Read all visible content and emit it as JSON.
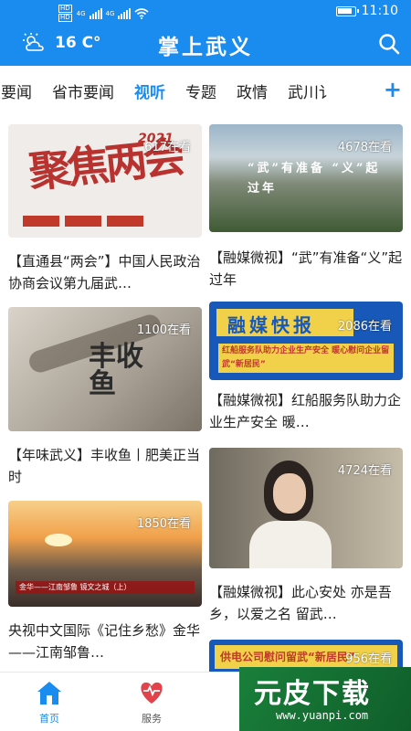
{
  "colors": {
    "accent": "#1a8cf0",
    "header_bg": "#1a8cf0"
  },
  "status": {
    "signal_badge_top": "HD",
    "signal_badge_bottom": "HD",
    "net1": "4G",
    "net2": "4G",
    "time": "11:10"
  },
  "header": {
    "temperature": "16 C°",
    "title": "掌上武义",
    "weather_icon": "partly-cloudy-icon",
    "search_icon": "search-icon"
  },
  "tabs": [
    "义要闻",
    "省市要闻",
    "视听",
    "专题",
    "政情",
    "武川讠"
  ],
  "active_tab_index": 2,
  "add_tab_label": "+",
  "feed": {
    "left": [
      {
        "views": "617在看",
        "title": "【直通县“两会”】中国人民政治协商会议第九届武…",
        "thumb_text": "聚焦两会",
        "thumb_year": "2021"
      },
      {
        "views": "1100在看",
        "title": "【年味武义】丰收鱼丨肥美正当时",
        "thumb_text": "丰收鱼"
      },
      {
        "views": "1850在看",
        "title": "央视中文国际《记住乡愁》金华——江南邹鲁…",
        "thumb_text": "金华——江南邹鲁 镜文之城（上）"
      }
    ],
    "right": [
      {
        "views": "4678在看",
        "title": "【融媒微视】“武”有准备“义”起过年",
        "thumb_text": "“武”有准备 “义”起过年"
      },
      {
        "views": "2086在看",
        "title": "【融媒微视】红船服务队助力企业生产安全 暖…",
        "thumb_text": "融媒快报",
        "thumb_sub": "红船服务队助力企业生产安全 暖心慰问企业留武“新居民”"
      },
      {
        "views": "4724在看",
        "title": "【融媒微视】此心安处 亦是吾乡，以爱之名 留武…"
      },
      {
        "views": "956在看",
        "thumb_text": "供电公司慰问留武“新居民”"
      }
    ]
  },
  "bottom_nav": [
    {
      "label": "首页",
      "icon": "home-icon",
      "active": true
    },
    {
      "label": "服务",
      "icon": "heart-icon",
      "active": false
    }
  ],
  "watermark": {
    "text": "元皮下载",
    "url": "www.yuanpi.com"
  }
}
